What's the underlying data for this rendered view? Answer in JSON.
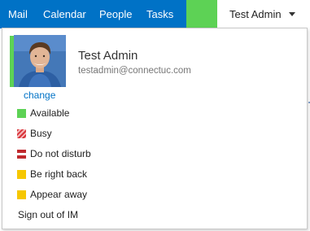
{
  "nav": {
    "items": [
      {
        "label": "Mail"
      },
      {
        "label": "Calendar"
      },
      {
        "label": "People"
      },
      {
        "label": "Tasks"
      }
    ]
  },
  "user": {
    "name": "Test Admin",
    "email": "testadmin@connectuc.com",
    "change_label": "change",
    "presence_color": "#5dd255"
  },
  "statuses": [
    {
      "label": "Available",
      "color": "#5dd255",
      "icon": "available-icon"
    },
    {
      "label": "Busy",
      "color": "#d9343a",
      "icon": "busy-icon"
    },
    {
      "label": "Do not disturb",
      "color": "#c02a2e",
      "icon": "do-not-disturb-icon"
    },
    {
      "label": "Be right back",
      "color": "#f6c700",
      "icon": "be-right-back-icon"
    },
    {
      "label": "Appear away",
      "color": "#f6c700",
      "icon": "appear-away-icon"
    }
  ],
  "signout_label": "Sign out of IM",
  "colors": {
    "nav_bg": "#0072c6",
    "link": "#0072c6"
  }
}
